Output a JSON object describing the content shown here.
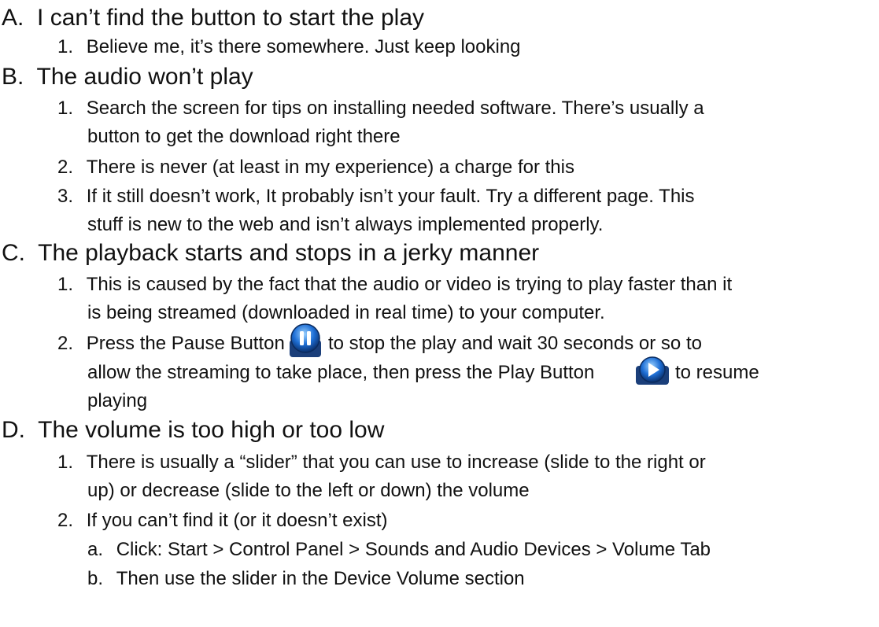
{
  "sections": [
    {
      "marker": "A.",
      "text": "I can’t find the button to start the play",
      "items": [
        {
          "marker": "1.",
          "lines": [
            "Believe me, it’s there somewhere.  Just keep looking"
          ]
        }
      ]
    },
    {
      "marker": "B.",
      "text": "The audio won’t play",
      "items": [
        {
          "marker": "1.",
          "lines": [
            "Search the screen for tips on installing needed software.  There’s usually a",
            "button to get the download right there"
          ]
        },
        {
          "marker": "2.",
          "lines": [
            "There is never (at least in my experience) a charge for this"
          ]
        },
        {
          "marker": "3.",
          "lines": [
            "If it still doesn’t work, It probably isn’t your fault.  Try a different page.  This",
            "stuff is new to the web and isn’t always implemented properly."
          ]
        }
      ]
    },
    {
      "marker": "C.",
      "text": "The playback starts and stops in a jerky manner",
      "items": [
        {
          "marker": "1.",
          "lines": [
            "This is caused by the fact that the audio or video is trying to play faster than it",
            "is being streamed (downloaded in real time) to your computer."
          ]
        },
        {
          "marker": "2.",
          "parts": {
            "p1": "Press the Pause Button",
            "p2": "to stop the play and wait 30 seconds or so to",
            "p3": "allow the streaming to take place, then press the Play Button",
            "p4": "to resume",
            "p5": "playing"
          }
        }
      ]
    },
    {
      "marker": "D.",
      "text": "The volume is too high or too low",
      "items": [
        {
          "marker": "1.",
          "lines": [
            "There is usually a “slider” that you can use to increase (slide to the right or",
            "up) or decrease (slide to the left or down) the volume"
          ]
        },
        {
          "marker": "2.",
          "lines": [
            "If you can’t find it (or it doesn’t exist)"
          ]
        }
      ]
    }
  ],
  "subitems": [
    {
      "marker": "a.",
      "text": "Click: Start > Control Panel > Sounds and Audio Devices > Volume Tab"
    },
    {
      "marker": "b.",
      "text": "Then use the slider in the Device Volume section"
    }
  ],
  "icons": {
    "pause": "pause-button-icon",
    "play": "play-button-icon",
    "accent": "#1e6fd6"
  }
}
